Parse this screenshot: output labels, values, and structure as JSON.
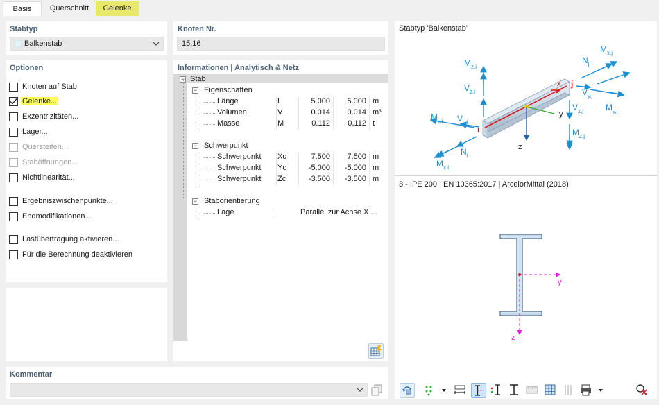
{
  "tabs": [
    "Basis",
    "Querschnitt",
    "Gelenke"
  ],
  "stabtyp": {
    "heading": "Stabtyp",
    "value": "Balkenstab"
  },
  "knoten": {
    "heading": "Knoten Nr.",
    "value": "15,16"
  },
  "optionen": {
    "heading": "Optionen",
    "items": [
      {
        "label": "Knoten auf Stab",
        "checked": false,
        "enabled": true
      },
      {
        "label": "Gelenke...",
        "checked": true,
        "enabled": true
      },
      {
        "label": "Exzentrizitäten...",
        "checked": false,
        "enabled": true
      },
      {
        "label": "Lager...",
        "checked": false,
        "enabled": true
      },
      {
        "label": "Quersteifen...",
        "checked": false,
        "enabled": false
      },
      {
        "label": "Staböffnungen...",
        "checked": false,
        "enabled": false
      },
      {
        "label": "Nichtlinearität...",
        "checked": false,
        "enabled": true
      },
      {
        "label": "Ergebniszwischenpunkte...",
        "checked": false,
        "enabled": true
      },
      {
        "label": "Endmodifikationen...",
        "checked": false,
        "enabled": true
      },
      {
        "label": "Lastübertragung aktivieren...",
        "checked": false,
        "enabled": true
      },
      {
        "label": "Für die Berechnung deaktivieren",
        "checked": false,
        "enabled": true
      }
    ]
  },
  "info": {
    "heading": "Informationen | Analytisch & Netz",
    "root": "Stab",
    "groups": [
      {
        "name": "Eigenschaften",
        "rows": [
          {
            "label": "Länge",
            "sym": "L",
            "v1": "5.000",
            "v2": "5.000",
            "unit": "m"
          },
          {
            "label": "Volumen",
            "sym": "V",
            "v1": "0.014",
            "v2": "0.014",
            "unit": "m³"
          },
          {
            "label": "Masse",
            "sym": "M",
            "v1": "0.112",
            "v2": "0.112",
            "unit": "t"
          }
        ]
      },
      {
        "name": "Schwerpunkt",
        "rows": [
          {
            "label": "Schwerpunkt",
            "sym": "Xc",
            "v1": "7.500",
            "v2": "7.500",
            "unit": "m"
          },
          {
            "label": "Schwerpunkt",
            "sym": "Yc",
            "v1": "-5.000",
            "v2": "-5.000",
            "unit": "m"
          },
          {
            "label": "Schwerpunkt",
            "sym": "Zc",
            "v1": "-3.500",
            "v2": "-3.500",
            "unit": "m"
          }
        ]
      },
      {
        "name": "Staborientierung",
        "rows": [
          {
            "label": "Lage",
            "sym": "",
            "v1": "Parallel zur Achse X ...",
            "v2": "",
            "unit": ""
          }
        ]
      }
    ]
  },
  "kommentar": {
    "heading": "Kommentar",
    "value": ""
  },
  "preview": {
    "title": "Stabtyp 'Balkenstab'",
    "section_caption": "3 - IPE 200 | EN 10365:2017 | ArcelorMittal (2018)",
    "diagram_labels": {
      "mzi": "M",
      "mzi_sub": "z,i",
      "vzi": "V",
      "vzi_sub": "z,i",
      "myi": "M",
      "myi_sub": "y,i",
      "vyi": "V",
      "vyi_sub": "y,i",
      "ni": "N",
      "ni_sub": "i",
      "mxi": "M",
      "mxi_sub": "x,i",
      "mxj": "M",
      "mxj_sub": "x,j",
      "nj": "N",
      "nj_sub": "j",
      "vyj": "V",
      "vyj_sub": "y,j",
      "myj": "M",
      "myj_sub": "y,j",
      "vzj": "V",
      "vzj_sub": "z,j",
      "mzj": "M",
      "mzj_sub": "z,j",
      "node_i": "i",
      "node_j": "j",
      "ax_x": "x",
      "ax_y": "y",
      "ax_z": "z"
    },
    "section_labels": {
      "y": "y",
      "z": "z"
    }
  },
  "colors": {
    "accent_blue": "#1c8fd3",
    "node_red": "#d81e1e",
    "axis_magenta": "#e020e0",
    "highlight": "#e8e86a"
  }
}
